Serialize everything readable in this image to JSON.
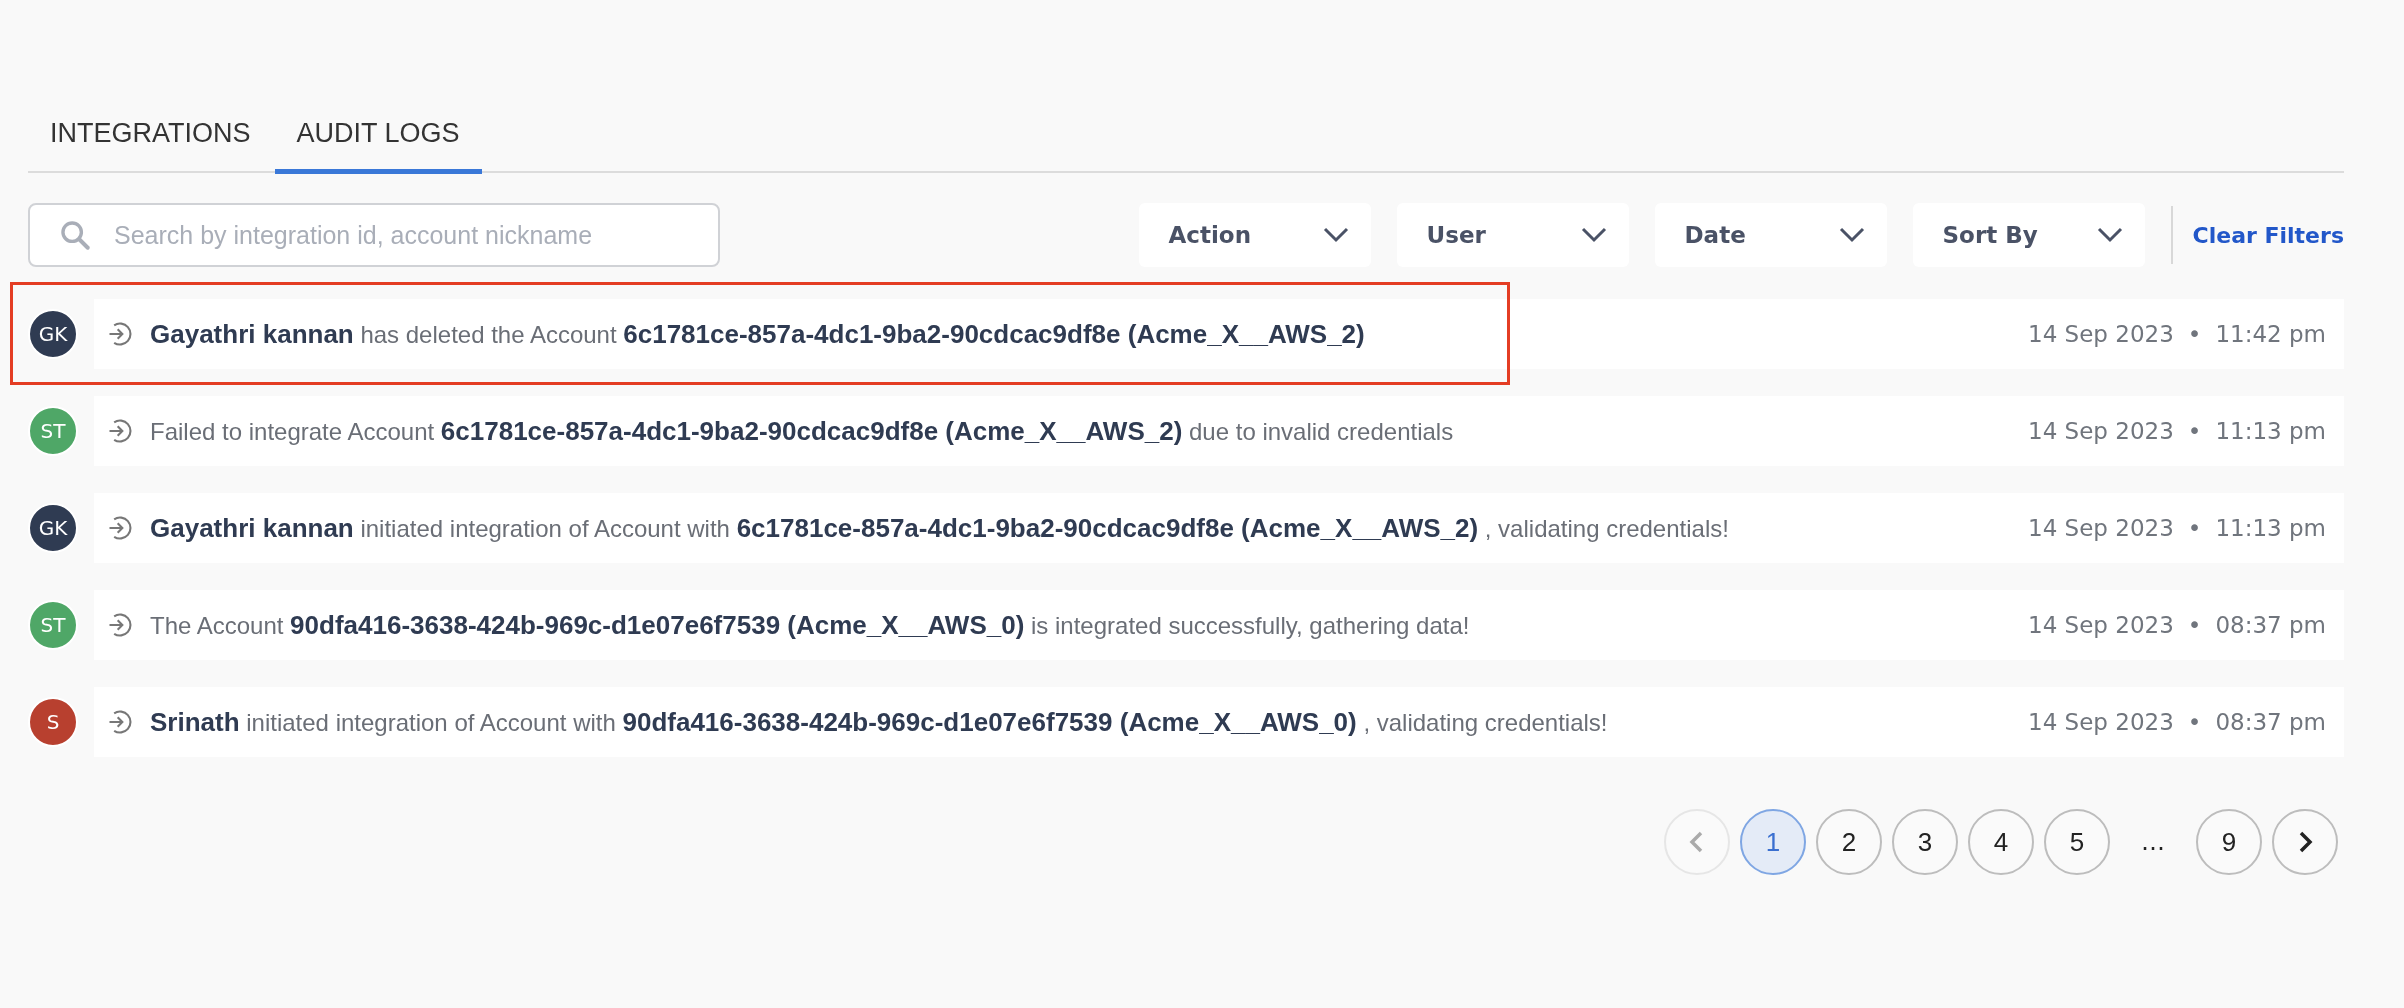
{
  "tabs": [
    {
      "label": "INTEGRATIONS",
      "selected": false
    },
    {
      "label": "AUDIT LOGS",
      "selected": true
    }
  ],
  "search": {
    "placeholder": "Search by integration id, account nickname"
  },
  "filters": [
    {
      "label": "Action"
    },
    {
      "label": "User"
    },
    {
      "label": "Date"
    },
    {
      "label": "Sort By"
    }
  ],
  "clear_filters": "Clear Filters",
  "logs": [
    {
      "initials": "GK",
      "color": "#2f3b52",
      "highlighted": true,
      "message": "**Gayathri kannan** has deleted the Account **6c1781ce-857a-4dc1-9ba2-90cdcac9df8e (Acme_X__AWS_2)**",
      "date": "14 Sep 2023",
      "separator": "•",
      "time": "11:42 pm"
    },
    {
      "initials": "ST",
      "color": "#4fa767",
      "highlighted": false,
      "message": "Failed to integrate Account **6c1781ce-857a-4dc1-9ba2-90cdcac9df8e (Acme_X__AWS_2)** due to invalid credentials",
      "date": "14 Sep 2023",
      "separator": "•",
      "time": "11:13 pm"
    },
    {
      "initials": "GK",
      "color": "#2f3b52",
      "highlighted": false,
      "message": "**Gayathri kannan** initiated integration of Account with **6c1781ce-857a-4dc1-9ba2-90cdcac9df8e (Acme_X__AWS_2)** , validating credentials!",
      "date": "14 Sep 2023",
      "separator": "•",
      "time": "11:13 pm"
    },
    {
      "initials": "ST",
      "color": "#4fa767",
      "highlighted": false,
      "message": "The Account **90dfa416-3638-424b-969c-d1e07e6f7539 (Acme_X__AWS_0)** is integrated successfully, gathering data!",
      "date": "14 Sep 2023",
      "separator": "•",
      "time": "08:37 pm"
    },
    {
      "initials": "S",
      "color": "#b8402f",
      "highlighted": false,
      "message": "**Srinath** initiated integration of Account with **90dfa416-3638-424b-969c-d1e07e6f7539 (Acme_X__AWS_0)** , validating credentials!",
      "date": "14 Sep 2023",
      "separator": "•",
      "time": "08:37 pm"
    }
  ],
  "pagination": {
    "previous_disabled": true,
    "next_disabled": false,
    "pages": [
      {
        "kind": "page",
        "label": "1",
        "selected": true
      },
      {
        "kind": "page",
        "label": "2",
        "selected": false
      },
      {
        "kind": "page",
        "label": "3",
        "selected": false
      },
      {
        "kind": "page",
        "label": "4",
        "selected": false
      },
      {
        "kind": "page",
        "label": "5",
        "selected": false
      },
      {
        "kind": "ellipsis",
        "label": "…"
      },
      {
        "kind": "page",
        "label": "9",
        "selected": false
      }
    ]
  }
}
